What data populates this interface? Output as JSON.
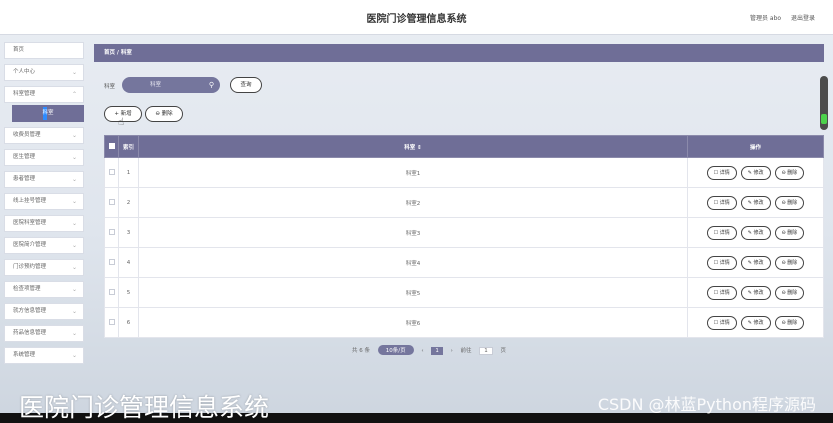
{
  "header": {
    "title": "医院门诊管理信息系统",
    "admin_label": "管理员 abo",
    "logout_label": "退出登录"
  },
  "sidebar": {
    "items": [
      {
        "label": "首页",
        "chevron": false
      },
      {
        "label": "个人中心",
        "chevron": true
      },
      {
        "label": "科室管理",
        "chevron": true
      },
      {
        "label": "收费员管理",
        "chevron": true
      },
      {
        "label": "医生管理",
        "chevron": true
      },
      {
        "label": "患者管理",
        "chevron": true
      },
      {
        "label": "线上挂号管理",
        "chevron": true
      },
      {
        "label": "医院科室管理",
        "chevron": true
      },
      {
        "label": "医院简介管理",
        "chevron": true
      },
      {
        "label": "门诊预约管理",
        "chevron": true
      },
      {
        "label": "检查项管理",
        "chevron": true
      },
      {
        "label": "就方信息管理",
        "chevron": true
      },
      {
        "label": "药品信息管理",
        "chevron": true
      },
      {
        "label": "系统管理",
        "chevron": true
      }
    ],
    "active_sub": "科室"
  },
  "breadcrumb": "首页 / 科室",
  "search": {
    "label": "科室",
    "placeholder": "科室",
    "button": "查询"
  },
  "actions": {
    "add": "+ 新增",
    "delete": "⊖ 删除"
  },
  "table": {
    "headers": {
      "index": "索引",
      "name": "科室 ⇕",
      "ops": "操作"
    },
    "rows": [
      {
        "index": "1",
        "name": "科室1"
      },
      {
        "index": "2",
        "name": "科室2"
      },
      {
        "index": "3",
        "name": "科室3"
      },
      {
        "index": "4",
        "name": "科室4"
      },
      {
        "index": "5",
        "name": "科室5"
      },
      {
        "index": "6",
        "name": "科室6"
      }
    ],
    "row_ops": {
      "detail": "☐ 详情",
      "edit": "✎ 修改",
      "delete": "⊖ 删除"
    }
  },
  "pager": {
    "total": "共 6 条",
    "size": "10条/页",
    "prev": "‹",
    "page": "1",
    "next": "›",
    "goto_label": "前往",
    "goto_value": "1",
    "page_suffix": "页"
  },
  "overlay": {
    "title": "医院门诊管理信息系统",
    "watermark": "CSDN @林蓝Python程序源码"
  },
  "colors": {
    "accent": "#6f6e97",
    "input_bg": "#75769d"
  }
}
